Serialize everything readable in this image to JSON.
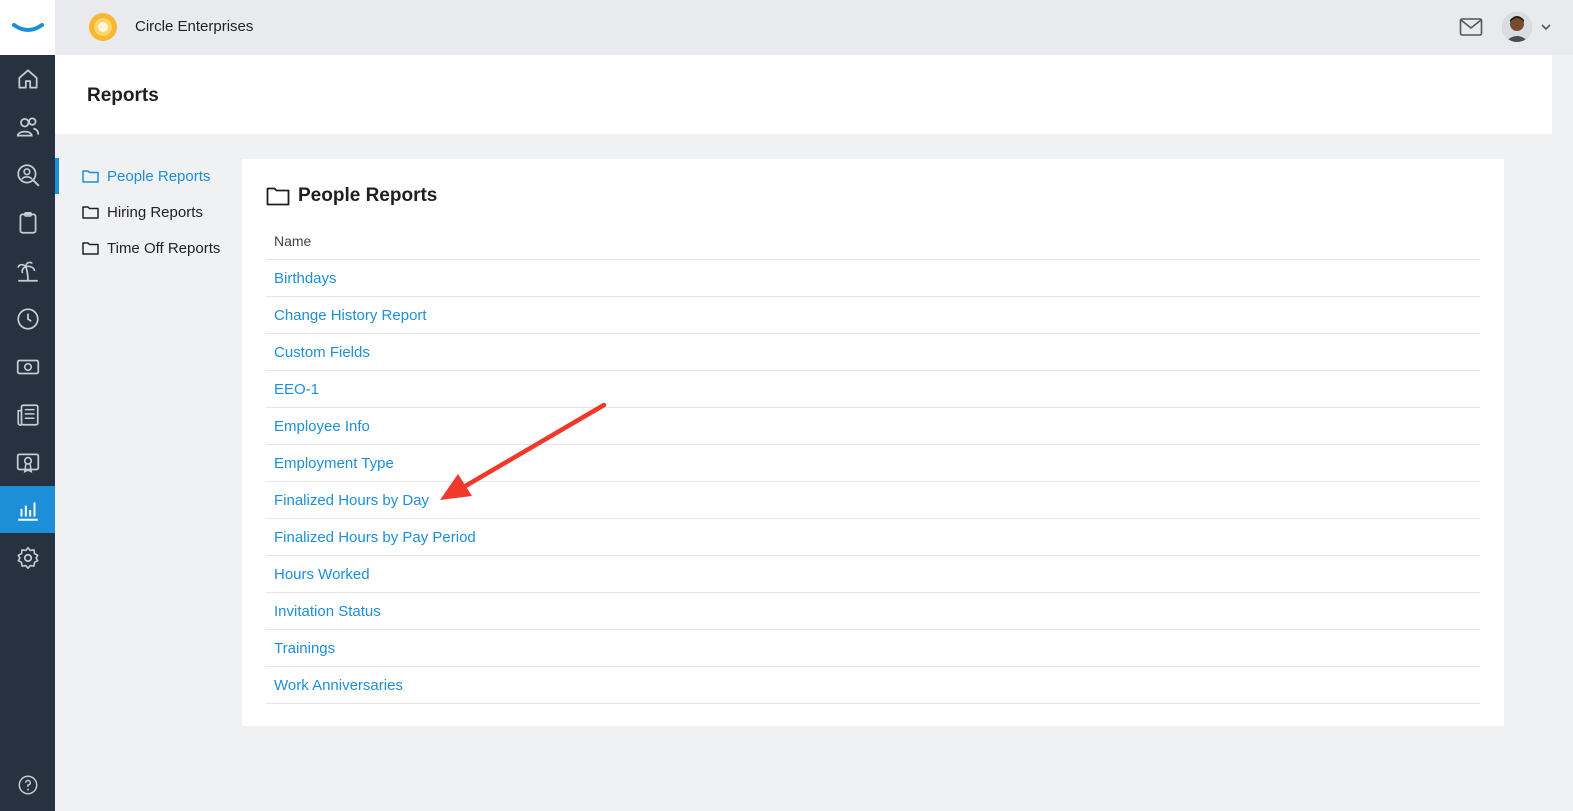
{
  "colors": {
    "accent": "#1d8fd8",
    "sidebar_bg": "#26323f",
    "annotation_arrow": "#f0392b"
  },
  "sidebar": {
    "items": [
      {
        "icon": "home-icon"
      },
      {
        "icon": "people-icon"
      },
      {
        "icon": "hiring-search-icon"
      },
      {
        "icon": "clipboard-icon"
      },
      {
        "icon": "palm-tree-icon"
      },
      {
        "icon": "clock-icon"
      },
      {
        "icon": "cash-icon"
      },
      {
        "icon": "newspaper-icon"
      },
      {
        "icon": "certificate-icon"
      },
      {
        "icon": "reports-chart-icon",
        "active": true
      },
      {
        "icon": "gear-icon"
      }
    ],
    "help_icon": "help-icon"
  },
  "topbar": {
    "company_name": "Circle Enterprises"
  },
  "page": {
    "title": "Reports"
  },
  "folders": [
    {
      "label": "People Reports",
      "active": true
    },
    {
      "label": "Hiring Reports"
    },
    {
      "label": "Time Off Reports"
    }
  ],
  "card": {
    "title": "People Reports",
    "column_header": "Name",
    "reports": [
      "Birthdays",
      "Change History Report",
      "Custom Fields",
      "EEO-1",
      "Employee Info",
      "Employment Type",
      "Finalized Hours by Day",
      "Finalized Hours by Pay Period",
      "Hours Worked",
      "Invitation Status",
      "Trainings",
      "Work Anniversaries"
    ]
  }
}
